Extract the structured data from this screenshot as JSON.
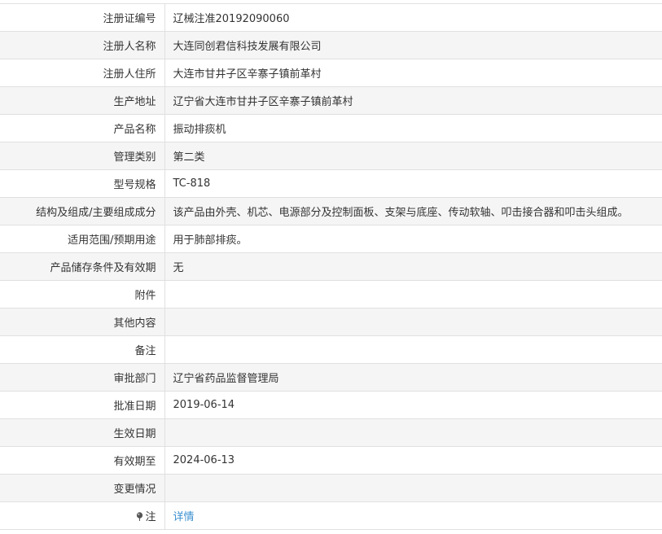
{
  "rows": [
    {
      "label": "注册证编号",
      "value": "辽械注准20192090060"
    },
    {
      "label": "注册人名称",
      "value": "大连同创君信科技发展有限公司"
    },
    {
      "label": "注册人住所",
      "value": "大连市甘井子区辛寨子镇前革村"
    },
    {
      "label": "生产地址",
      "value": "辽宁省大连市甘井子区辛寨子镇前革村"
    },
    {
      "label": "产品名称",
      "value": "振动排痰机"
    },
    {
      "label": "管理类别",
      "value": "第二类"
    },
    {
      "label": "型号规格",
      "value": "TC-818"
    },
    {
      "label": "结构及组成/主要组成成分",
      "value": "该产品由外壳、机芯、电源部分及控制面板、支架与底座、传动软轴、叩击接合器和叩击头组成。"
    },
    {
      "label": "适用范围/预期用途",
      "value": "用于肺部排痰。"
    },
    {
      "label": "产品储存条件及有效期",
      "value": "无"
    },
    {
      "label": "附件",
      "value": ""
    },
    {
      "label": "其他内容",
      "value": ""
    },
    {
      "label": "备注",
      "value": ""
    },
    {
      "label": "审批部门",
      "value": "辽宁省药品监督管理局"
    },
    {
      "label": "批准日期",
      "value": "2019-06-14"
    },
    {
      "label": "生效日期",
      "value": ""
    },
    {
      "label": "有效期至",
      "value": "2024-06-13"
    },
    {
      "label": "变更情况",
      "value": ""
    }
  ],
  "note": {
    "label": "注",
    "link_text": "详情",
    "icon": "pin-icon"
  },
  "colors": {
    "link": "#3a8fd0",
    "border": "#e0e0e0",
    "stripe": "#f5f5f5"
  }
}
